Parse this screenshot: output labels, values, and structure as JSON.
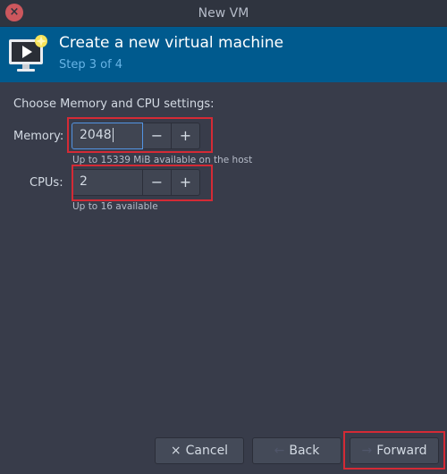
{
  "window": {
    "title": "New VM"
  },
  "header": {
    "title": "Create a new virtual machine",
    "step": "Step 3 of 4",
    "icon": "monitor-new-vm-icon"
  },
  "section_title": "Choose Memory and CPU settings:",
  "memory": {
    "label": "Memory:",
    "value": "2048",
    "hint": "Up to 15339 MiB available on the host"
  },
  "cpus": {
    "label": "CPUs:",
    "value": "2",
    "hint": "Up to 16 available"
  },
  "spin": {
    "minus": "−",
    "plus": "+"
  },
  "footer": {
    "cancel": {
      "label": "Cancel",
      "icon": "×"
    },
    "back": {
      "label": "Back",
      "icon": "←"
    },
    "forward": {
      "label": "Forward",
      "icon": "→"
    }
  },
  "colors": {
    "header_bg": "#005a8e",
    "window_bg": "#383c4a",
    "highlight": "#d42a35",
    "focus": "#5294e2"
  }
}
